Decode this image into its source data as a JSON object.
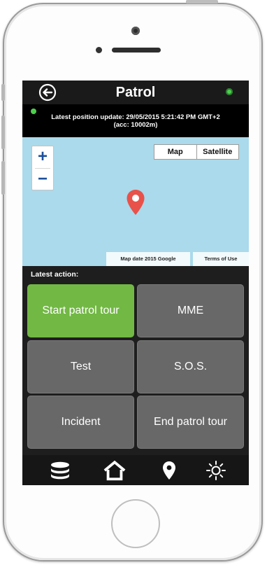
{
  "header": {
    "title": "Patrol"
  },
  "position_bar": {
    "line1": "Latest position update: 29/05/2015 5:21:42 PM GMT+2",
    "line2": "(acc: 10002m)"
  },
  "map": {
    "zoom_in": "+",
    "zoom_out": "−",
    "type_map": "Map",
    "type_satellite": "Satellite",
    "attribution": "Map date 2015 Google",
    "terms": "Terms of Use"
  },
  "latest_action_label": "Latest action:",
  "actions": [
    {
      "label": "Start patrol tour",
      "active": true
    },
    {
      "label": "MME",
      "active": false
    },
    {
      "label": "Test",
      "active": false
    },
    {
      "label": "S.O.S.",
      "active": false
    },
    {
      "label": "Incident",
      "active": false
    },
    {
      "label": "End patrol tour",
      "active": false
    }
  ],
  "tabbar": {
    "icons": [
      "database-icon",
      "home-icon",
      "location-pin-icon",
      "brightness-icon"
    ]
  },
  "colors": {
    "active_green": "#72b844",
    "button_gray": "#686868",
    "status_green": "#4cd04c",
    "pin_red": "#e8524a",
    "map_water": "#aadaeb",
    "zoom_blue": "#1b4f9c"
  }
}
